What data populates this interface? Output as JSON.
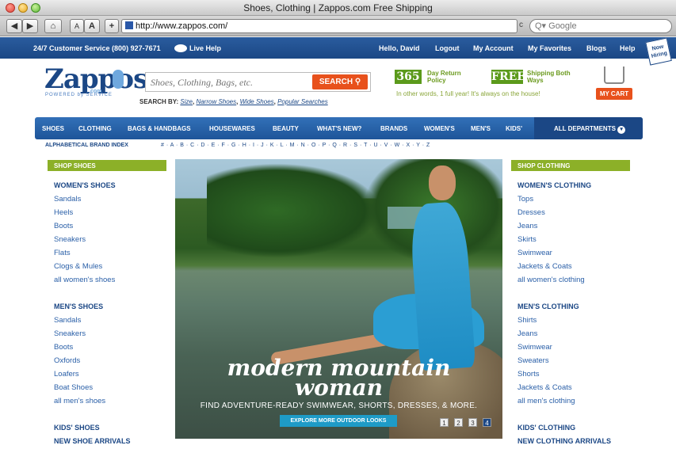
{
  "window": {
    "title": "Shoes, Clothing | Zappos.com Free Shipping"
  },
  "toolbar": {
    "back": "◀",
    "forward": "▶",
    "home": "⌂",
    "font_small": "A",
    "font_large": "A",
    "add": "+",
    "url": "http://www.zappos.com/",
    "reload": "c",
    "search_placeholder": "Q▾ Google"
  },
  "topbar": {
    "service": "24/7 Customer Service (800) 927-7671",
    "live_help": "Live Help",
    "greeting": "Hello, David",
    "logout": "Logout",
    "account": "My Account",
    "favorites": "My Favorites",
    "blogs": "Blogs",
    "help": "Help",
    "hiring": "Now Hiring"
  },
  "header": {
    "logo": "Zappos",
    "logo_sub": "POWERED by SERVICE",
    "logo_dotcom": ".com",
    "search_placeholder": "Shoes, Clothing, Bags, etc.",
    "search_button": "SEARCH",
    "search_by_label": "SEARCH BY:",
    "search_by_links": [
      "Size",
      "Narrow Shoes",
      "Wide Shoes",
      "Popular Searches"
    ],
    "badge_365": "365",
    "badge_365_text": "Day Return Policy",
    "badge_free": "FREE",
    "badge_free_text": "Shipping Both Ways",
    "tagline": "In other words, 1 full year! It's always on the house!",
    "cart": "MY CART"
  },
  "nav": {
    "items": [
      "SHOES",
      "CLOTHING",
      "BAGS & HANDBAGS",
      "HOUSEWARES",
      "BEAUTY",
      "WHAT'S NEW?",
      "BRANDS",
      "WOMEN'S",
      "MEN'S",
      "KIDS'"
    ],
    "all_departments": "ALL DEPARTMENTS"
  },
  "alpha": {
    "label": "ALPHABETICAL BRAND INDEX",
    "letters": "# · A · B · C · D · E · F · G · H · I · J · K · L · M · N · O · P · Q · R · S · T · U · V · W · X · Y · Z"
  },
  "left": {
    "head": "SHOP SHOES",
    "items": [
      {
        "t": "WOMEN'S SHOES",
        "h": true
      },
      {
        "t": "Sandals"
      },
      {
        "t": "Heels"
      },
      {
        "t": "Boots"
      },
      {
        "t": "Sneakers"
      },
      {
        "t": "Flats"
      },
      {
        "t": "Clogs & Mules"
      },
      {
        "t": "all women's shoes"
      },
      {
        "t": ""
      },
      {
        "t": "MEN'S SHOES",
        "h": true
      },
      {
        "t": "Sandals"
      },
      {
        "t": "Sneakers"
      },
      {
        "t": "Boots"
      },
      {
        "t": "Oxfords"
      },
      {
        "t": "Loafers"
      },
      {
        "t": "Boat Shoes"
      },
      {
        "t": "all men's shoes"
      },
      {
        "t": ""
      },
      {
        "t": "KIDS' SHOES",
        "h": true
      },
      {
        "t": "NEW SHOE ARRIVALS",
        "h": true
      }
    ]
  },
  "right": {
    "head": "SHOP CLOTHING",
    "items": [
      {
        "t": "WOMEN'S CLOTHING",
        "h": true
      },
      {
        "t": "Tops"
      },
      {
        "t": "Dresses"
      },
      {
        "t": "Jeans"
      },
      {
        "t": "Skirts"
      },
      {
        "t": "Swimwear"
      },
      {
        "t": "Jackets & Coats"
      },
      {
        "t": "all women's clothing"
      },
      {
        "t": ""
      },
      {
        "t": "MEN'S CLOTHING",
        "h": true
      },
      {
        "t": "Shirts"
      },
      {
        "t": "Jeans"
      },
      {
        "t": "Swimwear"
      },
      {
        "t": "Sweaters"
      },
      {
        "t": "Shorts"
      },
      {
        "t": "Jackets & Coats"
      },
      {
        "t": "all men's clothing"
      },
      {
        "t": ""
      },
      {
        "t": "KIDS' CLOTHING",
        "h": true
      },
      {
        "t": "NEW CLOTHING ARRIVALS",
        "h": true
      }
    ]
  },
  "hero": {
    "title_line1": "modern mountain",
    "title_line2": "woman",
    "subtitle": "FIND ADVENTURE-READY SWIMWEAR, SHORTS, DRESSES, & MORE.",
    "button": "EXPLORE MORE OUTDOOR LOOKS",
    "pages": [
      "1",
      "2",
      "3",
      "4"
    ],
    "active_page": "4"
  }
}
